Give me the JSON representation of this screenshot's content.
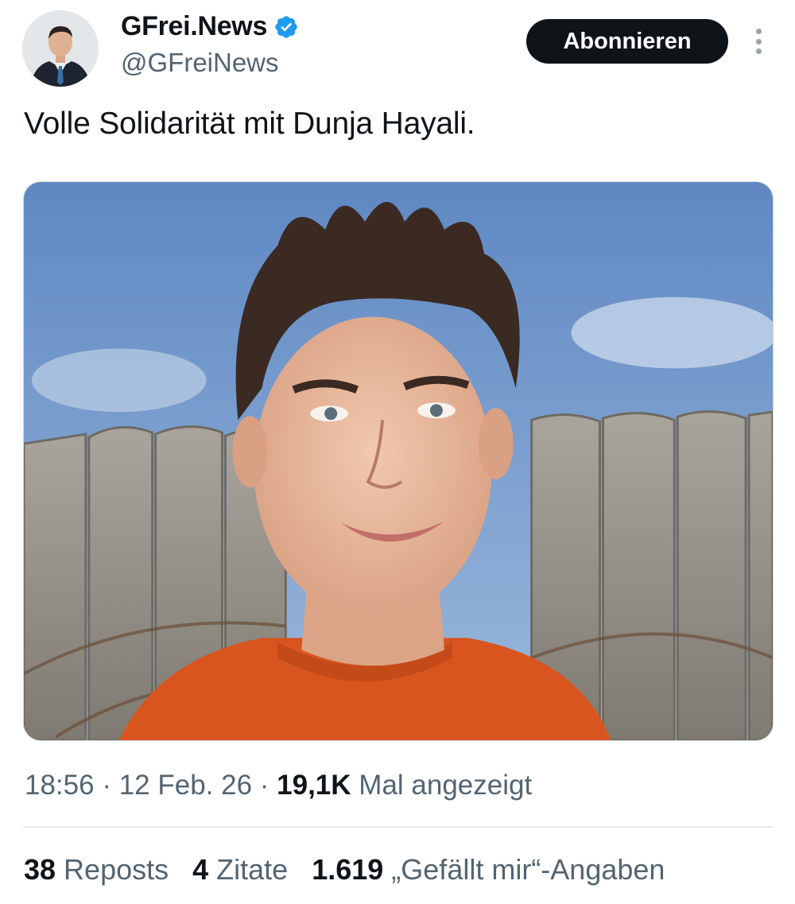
{
  "author": {
    "display_name": "GFrei.News",
    "handle": "@GFreiNews",
    "verified": true,
    "verified_icon": "verified-badge-icon",
    "verified_color": "#1d9bf0"
  },
  "actions": {
    "follow_label": "Abonnieren",
    "more_icon": "more-vertical-icon"
  },
  "tweet": {
    "text": "Volle Solidarität mit Dunja Hayali."
  },
  "meta": {
    "time": "18:56",
    "sep1": " · ",
    "date": "12 Feb. 26",
    "sep2": " · ",
    "views_count": "19,1K",
    "views_label": " Mal angezeigt"
  },
  "stats": [
    {
      "count": "38",
      "label": " Reposts"
    },
    {
      "count": "4",
      "label": " Zitate"
    },
    {
      "count": "1.619",
      "label": " „Gefällt mir“-Angaben"
    }
  ],
  "colors": {
    "text": "#0f1419",
    "secondary": "#536471",
    "button_bg": "#0f1419",
    "divider": "#e7e9ea"
  }
}
